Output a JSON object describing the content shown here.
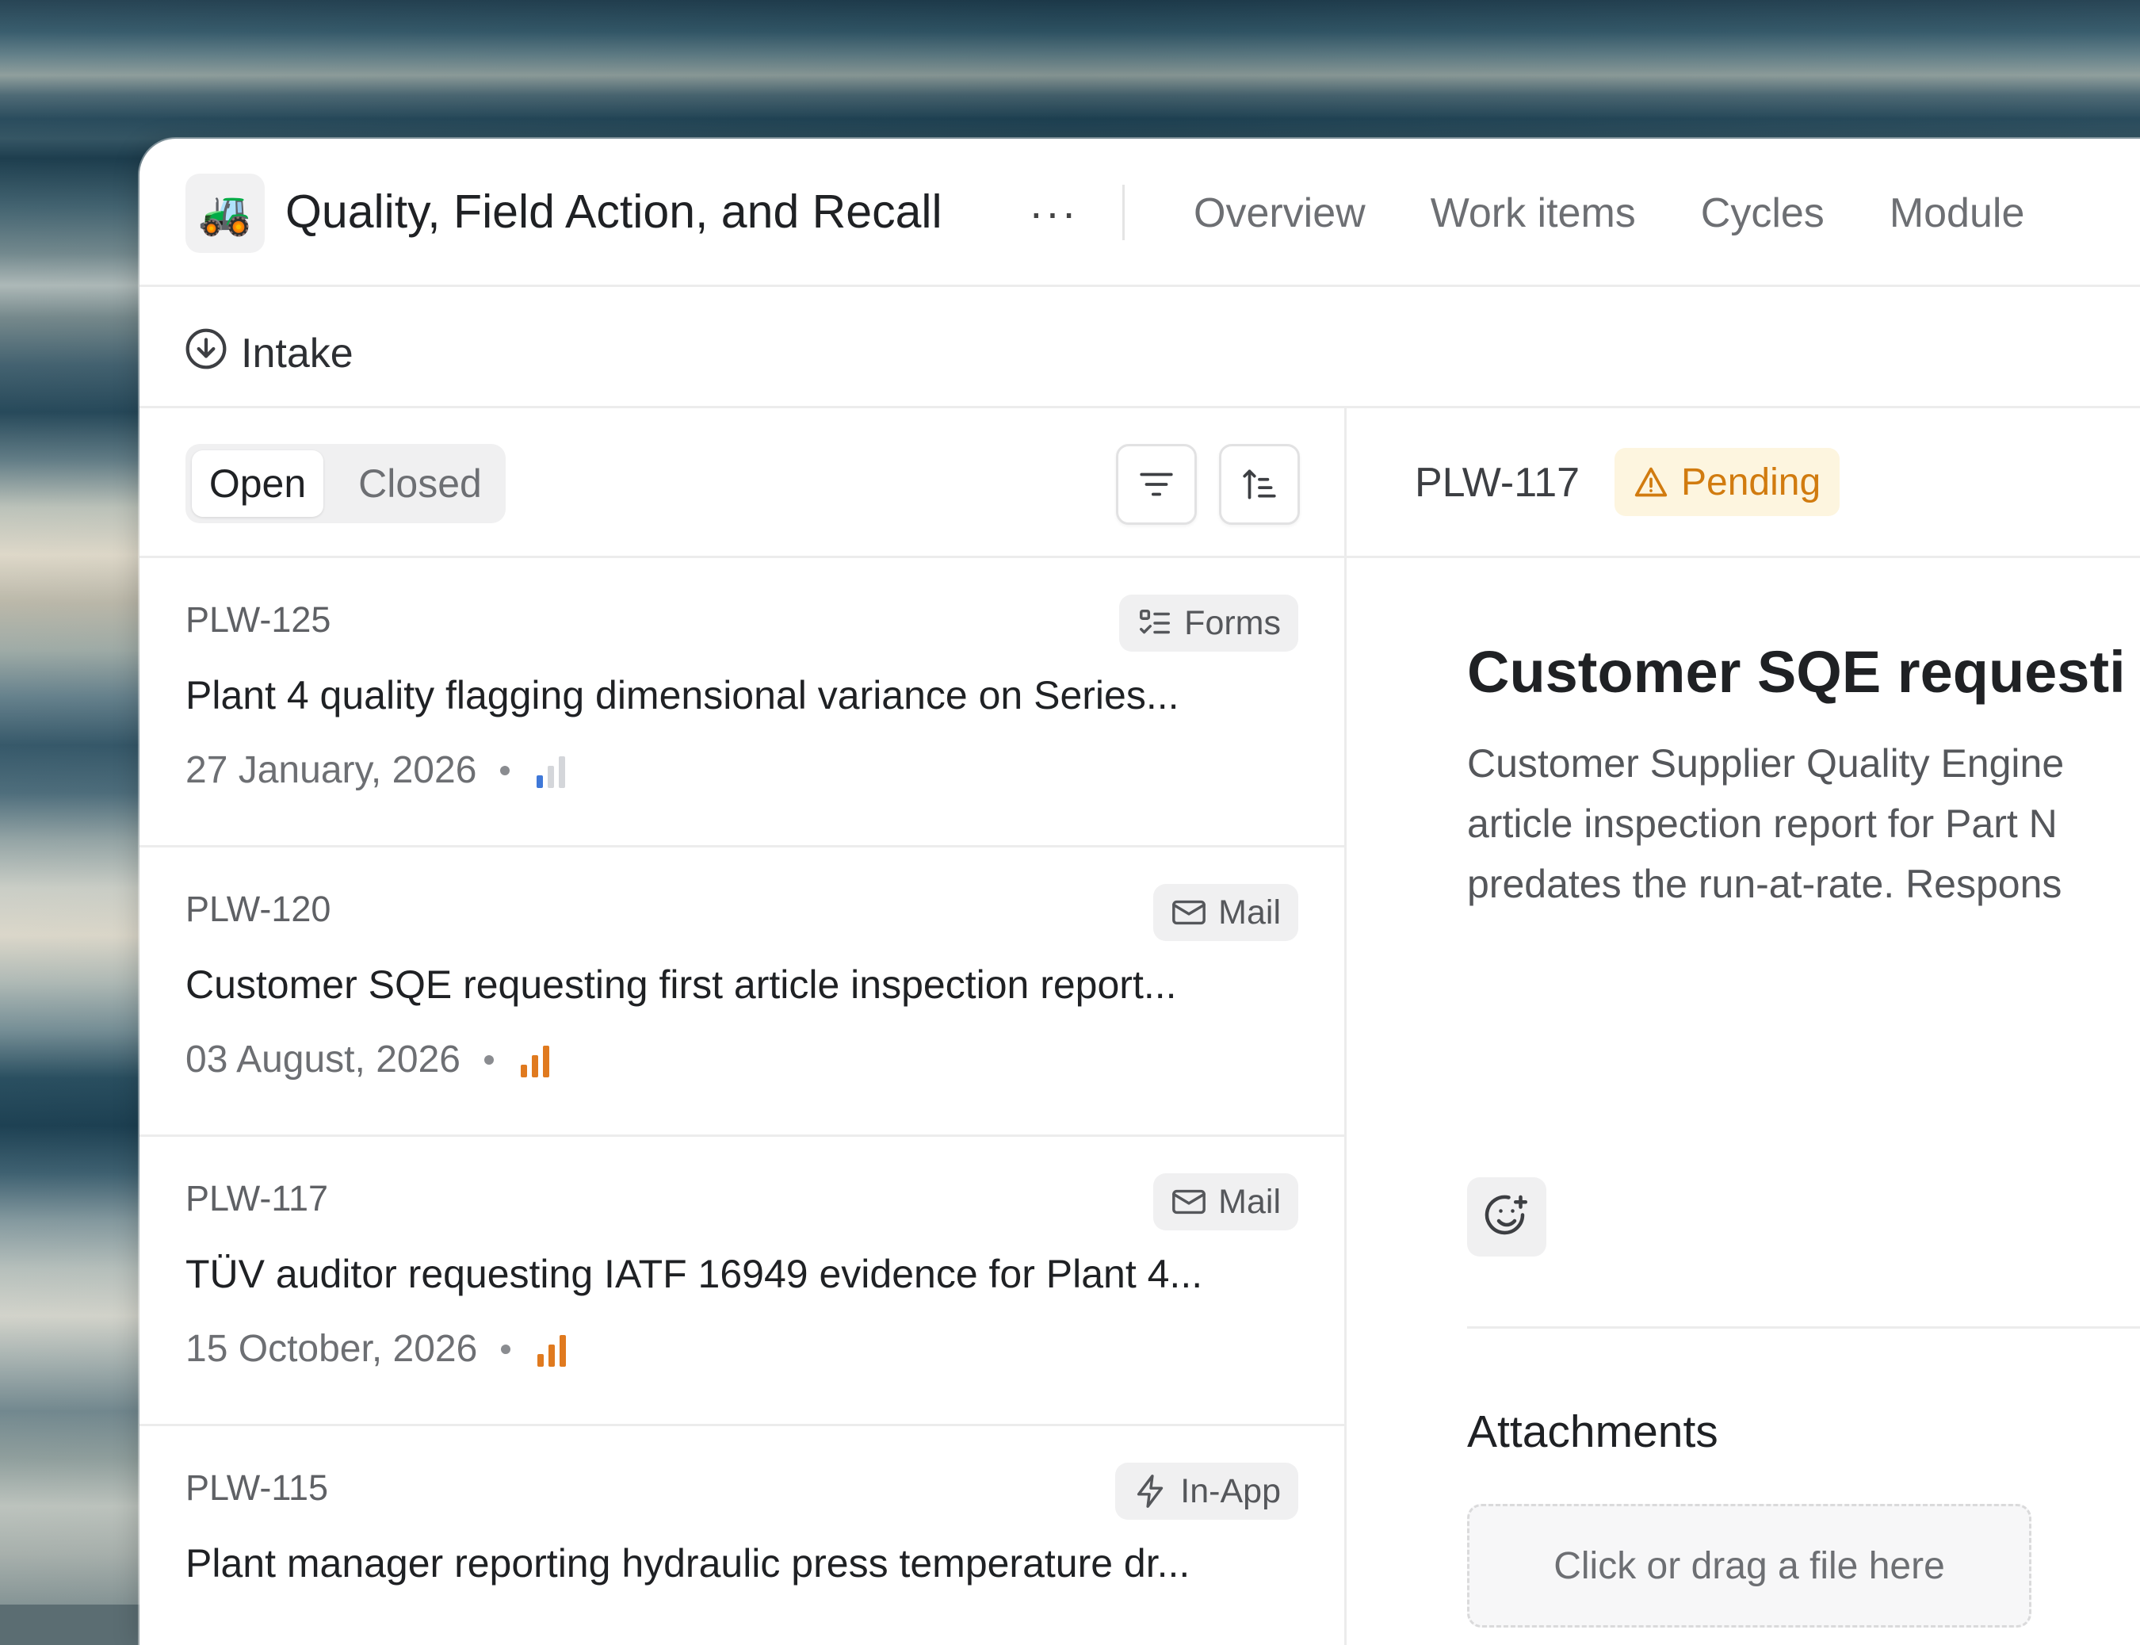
{
  "project": {
    "icon": "tractor-icon",
    "icon_glyph": "🚜",
    "title": "Quality, Field Action, and Recall",
    "more_label": "···"
  },
  "nav_tabs": [
    "Overview",
    "Work items",
    "Cycles",
    "Module"
  ],
  "intake": {
    "label": "Intake",
    "icon": "intake-download-circle-icon"
  },
  "list": {
    "segments": {
      "open": "Open",
      "closed": "Closed",
      "active": "Open"
    },
    "items": [
      {
        "id": "PLW-125",
        "source": "Forms",
        "source_icon": "forms-icon",
        "title": "Plant 4 quality flagging dimensional variance on Series...",
        "date": "27 January, 2026",
        "priority": "low",
        "priority_color": "#3f78d8"
      },
      {
        "id": "PLW-120",
        "source": "Mail",
        "source_icon": "mail-icon",
        "title": "Customer SQE requesting first article inspection report...",
        "date": "03 August, 2026",
        "priority": "high",
        "priority_color": "#e07a1f"
      },
      {
        "id": "PLW-117",
        "source": "Mail",
        "source_icon": "mail-icon",
        "title": "TÜV auditor requesting IATF 16949 evidence for Plant 4...",
        "date": "15 October, 2026",
        "priority": "high",
        "priority_color": "#e07a1f"
      },
      {
        "id": "PLW-115",
        "source": "In-App",
        "source_icon": "lightning-icon",
        "title": "Plant manager reporting hydraulic press temperature dr...",
        "date": "",
        "priority": "",
        "priority_color": ""
      }
    ]
  },
  "detail": {
    "id": "PLW-117",
    "status": "Pending",
    "status_color": "#d17b0f",
    "title": "Customer SQE requesti",
    "description_lines": [
      "Customer Supplier Quality Engine",
      "article inspection report for Part N",
      "predates the run-at-rate. Respons"
    ],
    "attachments_title": "Attachments",
    "dropzone_text": "Click or drag a file here"
  }
}
